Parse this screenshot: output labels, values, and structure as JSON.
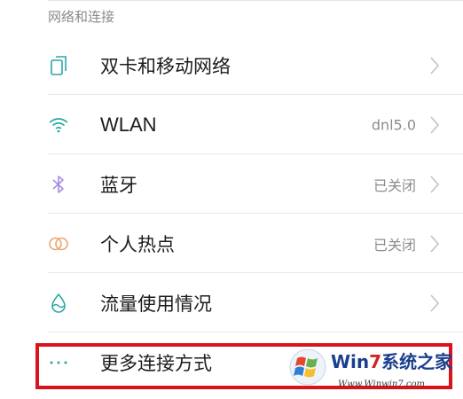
{
  "section": {
    "title": "网络和连接"
  },
  "items": [
    {
      "label": "双卡和移动网络",
      "value": "",
      "icon": "dual-sim-icon"
    },
    {
      "label": "WLAN",
      "value": "dnl5.0",
      "icon": "wifi-icon"
    },
    {
      "label": "蓝牙",
      "value": "已关闭",
      "icon": "bluetooth-icon"
    },
    {
      "label": "个人热点",
      "value": "已关闭",
      "icon": "hotspot-icon"
    },
    {
      "label": "流量使用情况",
      "value": "",
      "icon": "data-usage-icon"
    },
    {
      "label": "更多连接方式",
      "value": "",
      "icon": "more-dots-icon"
    }
  ],
  "watermark": {
    "brand_a": "Win",
    "brand_b": "7",
    "brand_c": "系统之家",
    "url": "Www.Winwin7.com"
  },
  "colors": {
    "accent_teal": "#2aa7a4",
    "bluetooth": "#a48ee0",
    "hotspot": "#f0a371",
    "highlight": "#d9121b",
    "chevron": "#c2c2c2"
  }
}
